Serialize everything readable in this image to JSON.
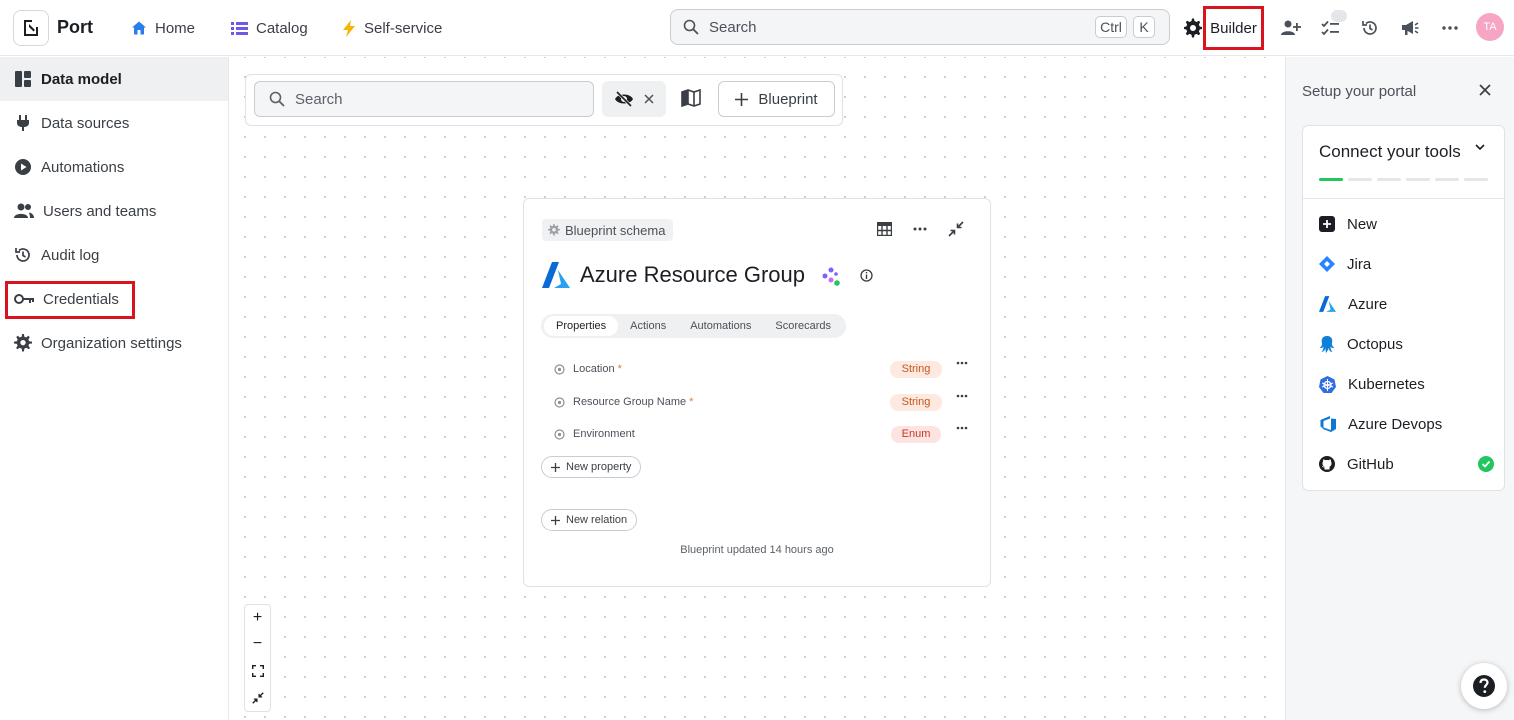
{
  "app": {
    "name": "Port"
  },
  "nav": {
    "home": "Home",
    "catalog": "Catalog",
    "self_service": "Self-service"
  },
  "search": {
    "placeholder": "Search",
    "shortcut_ctrl": "Ctrl",
    "shortcut_k": "K"
  },
  "builder": {
    "label": "Builder"
  },
  "user": {
    "initials": "TA"
  },
  "sidebar": {
    "items": [
      {
        "label": "Data model",
        "icon": "data-model-icon",
        "active": true
      },
      {
        "label": "Data sources",
        "icon": "plug-icon"
      },
      {
        "label": "Automations",
        "icon": "play-circle-icon"
      },
      {
        "label": "Users and teams",
        "icon": "users-icon"
      },
      {
        "label": "Audit log",
        "icon": "history-icon"
      },
      {
        "label": "Credentials",
        "icon": "key-icon"
      },
      {
        "label": "Organization settings",
        "icon": "gear-icon"
      }
    ]
  },
  "canvas_toolbar": {
    "search_placeholder": "Search",
    "blueprint_button": "Blueprint"
  },
  "blueprint_card": {
    "chip": "Blueprint schema",
    "title": "Azure Resource Group",
    "tabs": [
      "Properties",
      "Actions",
      "Automations",
      "Scorecards"
    ],
    "properties": [
      {
        "name": "Location",
        "required": "*",
        "type": "String"
      },
      {
        "name": "Resource Group Name",
        "required": "*",
        "type": "String"
      },
      {
        "name": "Environment",
        "required": "",
        "type": "Enum"
      }
    ],
    "new_property": "New property",
    "new_relation": "New relation",
    "updated": "Blueprint updated 14 hours ago"
  },
  "zoom_controls": {
    "zoom_in": "+",
    "zoom_out": "−"
  },
  "setup_panel": {
    "title": "Setup your portal",
    "section": "Connect your tools",
    "progress_steps": 6,
    "progress_done": 1,
    "tools": [
      "New",
      "Jira",
      "Azure",
      "Octopus",
      "Kubernetes",
      "Azure Devops",
      "GitHub"
    ]
  },
  "colors": {
    "accent_highlight": "#d9141e",
    "success": "#22c55e",
    "avatar": "#f6a5c4",
    "azure": "#0a6ad6"
  }
}
